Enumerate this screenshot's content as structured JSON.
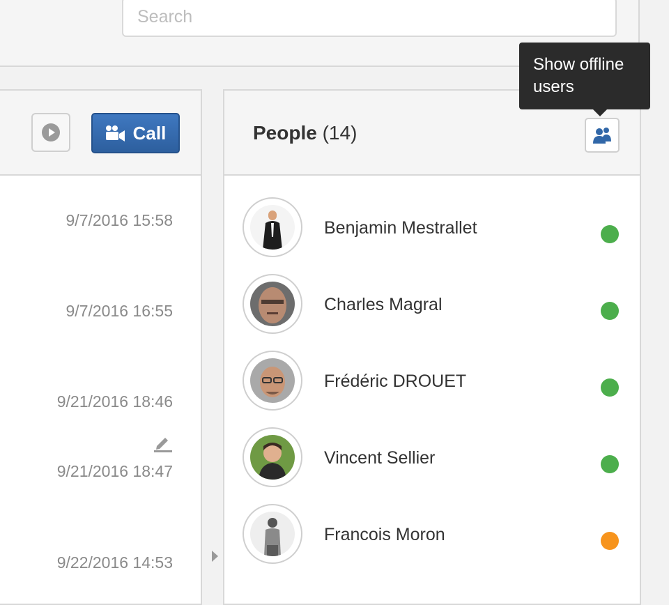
{
  "search": {
    "placeholder": "Search"
  },
  "chat": {
    "call_label": "Call",
    "timestamps": [
      "9/7/2016 15:58",
      "9/7/2016 16:55",
      "9/21/2016 18:46",
      "9/21/2016 18:47",
      "9/22/2016 14:53"
    ]
  },
  "people": {
    "title": "People",
    "count": "(14)",
    "tooltip": "Show offline users",
    "list": [
      {
        "name": "Benjamin Mestrallet",
        "status": "online"
      },
      {
        "name": "Charles Magral",
        "status": "online"
      },
      {
        "name": "Frédéric DROUET",
        "status": "online"
      },
      {
        "name": "Vincent Sellier",
        "status": "online"
      },
      {
        "name": "Francois Moron",
        "status": "away"
      }
    ]
  },
  "colors": {
    "online": "#4cae4c",
    "away": "#f7941d",
    "call_button": "#3167a8",
    "tooltip": "#2b2b2b"
  },
  "icons": {
    "play": "play-icon",
    "call": "video-camera-icon",
    "edit": "pencil-icon",
    "offline_users": "users-icon",
    "collapse": "caret-right-icon"
  }
}
